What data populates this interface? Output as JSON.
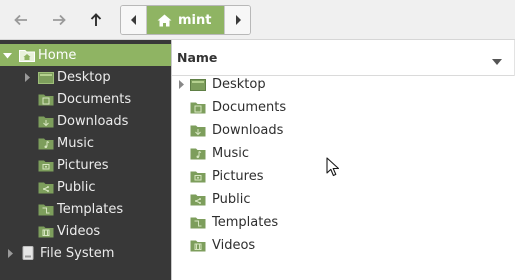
{
  "toolbar": {
    "back_icon": "arrow-left-icon",
    "forward_icon": "arrow-right-icon",
    "up_icon": "arrow-up-icon",
    "path": {
      "crumb_label": "mint",
      "crumb_icon": "home-icon"
    }
  },
  "colors": {
    "accent": "#8fb463",
    "sidebar_bg": "#383838",
    "folder": "#7d9e5c"
  },
  "sidebar": {
    "items": [
      {
        "label": "Home",
        "icon": "home-folder-icon",
        "expanded": true,
        "selected": true
      },
      {
        "label": "Desktop",
        "icon": "desktop-folder-icon"
      },
      {
        "label": "Documents",
        "icon": "documents-folder-icon"
      },
      {
        "label": "Downloads",
        "icon": "downloads-folder-icon"
      },
      {
        "label": "Music",
        "icon": "music-folder-icon"
      },
      {
        "label": "Pictures",
        "icon": "pictures-folder-icon"
      },
      {
        "label": "Public",
        "icon": "public-folder-icon"
      },
      {
        "label": "Templates",
        "icon": "templates-folder-icon"
      },
      {
        "label": "Videos",
        "icon": "videos-folder-icon"
      },
      {
        "label": "File System",
        "icon": "drive-icon"
      }
    ]
  },
  "main": {
    "column_header": "Name",
    "files": [
      {
        "label": "Desktop",
        "icon": "desktop-folder-icon"
      },
      {
        "label": "Documents",
        "icon": "documents-folder-icon"
      },
      {
        "label": "Downloads",
        "icon": "downloads-folder-icon"
      },
      {
        "label": "Music",
        "icon": "music-folder-icon"
      },
      {
        "label": "Pictures",
        "icon": "pictures-folder-icon"
      },
      {
        "label": "Public",
        "icon": "public-folder-icon"
      },
      {
        "label": "Templates",
        "icon": "templates-folder-icon"
      },
      {
        "label": "Videos",
        "icon": "videos-folder-icon"
      }
    ]
  }
}
